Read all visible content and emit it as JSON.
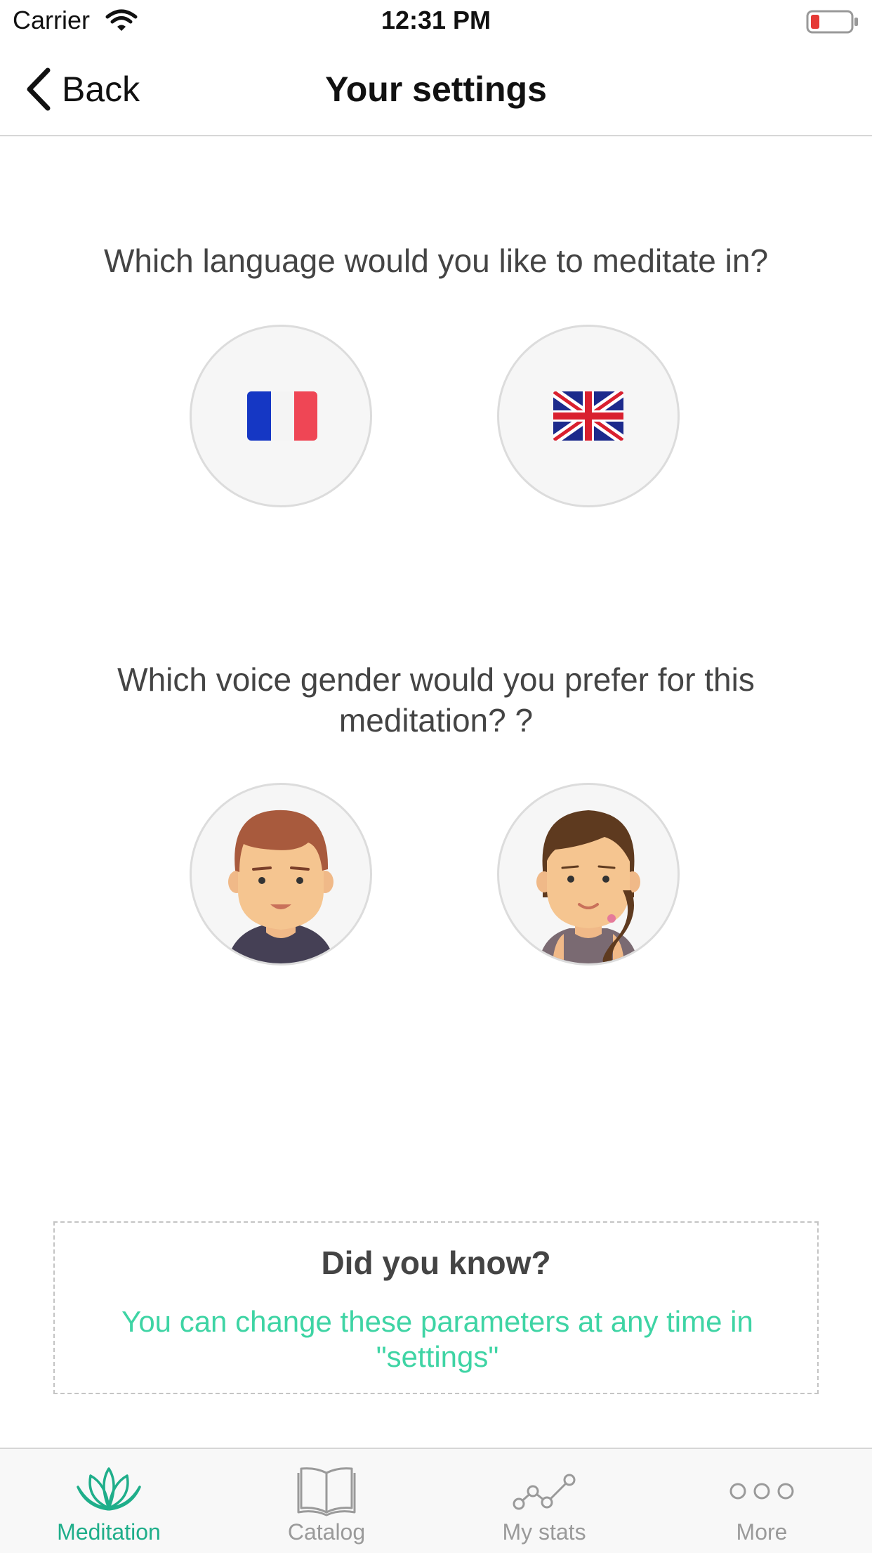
{
  "status_bar": {
    "carrier": "Carrier",
    "time": "12:31 PM",
    "battery_level": 0.1,
    "battery_color": "#e53935"
  },
  "nav": {
    "back_label": "Back",
    "title": "Your settings"
  },
  "language_section": {
    "question": "Which language would you like to meditate in?",
    "options": [
      {
        "name": "french-flag-icon"
      },
      {
        "name": "uk-flag-icon"
      }
    ]
  },
  "voice_section": {
    "question": "Which voice gender would you prefer for this meditation? ?",
    "options": [
      {
        "name": "male-avatar-icon"
      },
      {
        "name": "female-avatar-icon"
      }
    ]
  },
  "info_box": {
    "title": "Did you know?",
    "text": "You can change these parameters at any time in \"settings\"",
    "text_color": "#3ed4a4"
  },
  "tab_bar": {
    "tabs": [
      {
        "label": "Meditation",
        "icon": "lotus-icon",
        "active": true
      },
      {
        "label": "Catalog",
        "icon": "book-icon",
        "active": false
      },
      {
        "label": "My stats",
        "icon": "stats-line-icon",
        "active": false
      },
      {
        "label": "More",
        "icon": "more-dots-icon",
        "active": false
      }
    ],
    "active_color": "#1fae8a",
    "inactive_color": "#9a9a9a"
  }
}
